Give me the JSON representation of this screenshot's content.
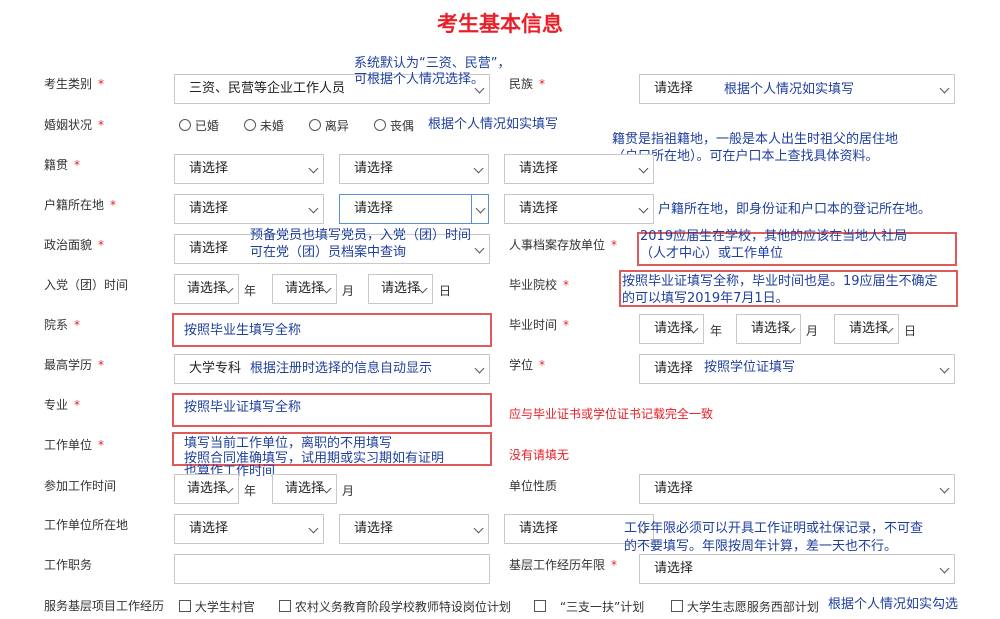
{
  "title": "考生基本信息",
  "placeholder": "请选择",
  "unit_year": "年",
  "unit_month": "月",
  "unit_day": "日",
  "labels": {
    "category": "考生类别",
    "ethnic": "民族",
    "marital": "婚姻状况",
    "native": "籍贯",
    "household": "户籍所在地",
    "political": "政治面貌",
    "archive": "人事档案存放单位",
    "party_time": "入党（团）时间",
    "school": "毕业院校",
    "department": "院系",
    "grad_time": "毕业时间",
    "education": "最高学历",
    "degree": "学位",
    "major": "专业",
    "employer": "工作单位",
    "work_start": "参加工作时间",
    "unit_nature": "单位性质",
    "employer_location": "工作单位所在地",
    "position": "工作职务",
    "grassroots_years": "基层工作经历年限",
    "service_projects": "服务基层项目工作经历"
  },
  "required_mark": "*",
  "values": {
    "category": "三资、民营等企业工作人员",
    "education": "大学专科"
  },
  "marital_options": [
    "已婚",
    "未婚",
    "离异",
    "丧偶"
  ],
  "service_options": [
    "大学生村官",
    "农村义务教育阶段学校教师特设岗位计划",
    "“三支一扶”计划",
    "大学生志愿服务西部计划"
  ],
  "notes": {
    "category_1": "系统默认为“三资、民营”，",
    "category_2": "可根据个人情况选择。",
    "ethnic": "根据个人情况如实填写",
    "marital": "根据个人情况如实填写",
    "native_1": "籍贯是指祖籍地，一般是本人出生时祖父的居住地",
    "native_2": "（户口所在地）。可在户口本上查找具体资料。",
    "household": "户籍所在地，即身份证和户口本的登记所在地。",
    "political_1": "预备党员也填写党员，入党（团）时间",
    "political_2": "可在党（团）员档案中查询",
    "archive_1": "2019应届生在学校，其他的应该在当地人社局",
    "archive_2": "（人才中心）或工作单位",
    "school_1": "按照毕业证填写全称，毕业时间也是。19应届生不确定",
    "school_2": "的可以填写2019年7月1日。",
    "department": "按照毕业生填写全称",
    "education": "根据注册时选择的信息自动显示",
    "degree": "按照学位证填写",
    "major": "按照毕业证填写全称",
    "major_red": "应与毕业证书或学位证书记载完全一致",
    "employer_1": "填写当前工作单位，离职的不用填写",
    "employer_2": "按照合同准确填写，试用期或实习期如有证明",
    "employer_3": "也算作工作时间",
    "employer_red": "没有请填无",
    "grassroots_1": "工作年限必须可以开具工作证明或社保记录，不可查",
    "grassroots_2": "的不要填写。年限按周年计算，差一天也不行。",
    "service": "根据个人情况如实勾选"
  }
}
